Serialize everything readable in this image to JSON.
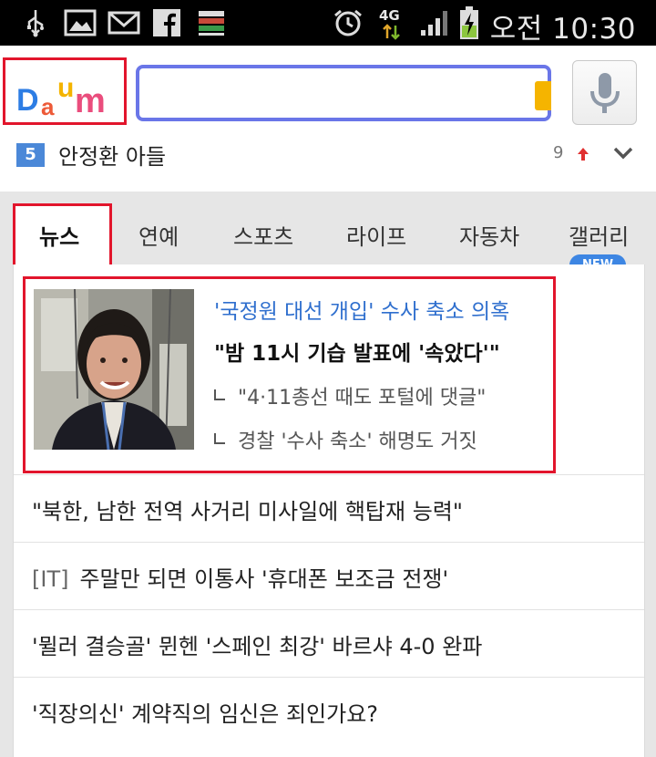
{
  "status_bar": {
    "time": "오전 10:30",
    "network": "4G",
    "icons": [
      "usb-icon",
      "gallery-icon",
      "gmail-icon",
      "facebook-icon",
      "app-icon",
      "alarm-icon",
      "network-4g-icon",
      "signal-icon",
      "battery-charging-icon"
    ]
  },
  "header": {
    "logo_text": "Daum",
    "search_value": "",
    "search_placeholder": "",
    "accent_border": "#6a76e8"
  },
  "trending": {
    "rank": "5",
    "keyword": "안정환 아들",
    "count": "9"
  },
  "tabs": {
    "items": [
      {
        "label": "뉴스",
        "active": true
      },
      {
        "label": "연예"
      },
      {
        "label": "스포츠"
      },
      {
        "label": "라이프"
      },
      {
        "label": "자동차"
      },
      {
        "label": "갤러리"
      }
    ],
    "new_badge": "NEW"
  },
  "news": {
    "headline": {
      "top": "'국정원 대선 개입' 수사 축소 의혹",
      "main": "\"밤 11시 기습 발표에 '속았다'\"",
      "subs": [
        "\"4·11총선 때도 포털에 댓글\"",
        "경찰 '수사 축소' 해명도 거짓"
      ]
    },
    "rows": [
      {
        "category": "",
        "text": "\"북한, 남한 전역 사거리 미사일에 핵탑재 능력\""
      },
      {
        "category": "[IT]",
        "text": "주말만 되면 이통사 '휴대폰 보조금 전쟁'"
      },
      {
        "category": "",
        "text": "'뮐러 결승골' 뮌헨 '스페인 최강' 바르샤 4-0 완파"
      },
      {
        "category": "",
        "text": "'직장의신' 계약직의 임신은 죄인가요?"
      }
    ]
  },
  "colors": {
    "highlight_red": "#e2152c",
    "link_blue": "#2f6fce",
    "rank_blue": "#4b88d8",
    "new_badge_blue": "#3d86e3"
  }
}
